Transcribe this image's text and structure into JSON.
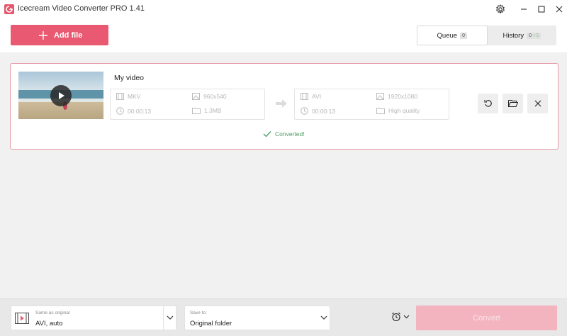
{
  "window": {
    "title": "Icecream Video Converter PRO 1.41"
  },
  "toolbar": {
    "add_file_label": "Add file",
    "tabs": [
      {
        "label": "Queue",
        "count": "0",
        "active": true
      },
      {
        "label": "History",
        "count": "0",
        "count_sub": "+3",
        "active": false
      }
    ]
  },
  "item": {
    "title": "My video",
    "source": {
      "format": "MKV",
      "resolution": "960x540",
      "duration": "00:00:13",
      "size": "1.3MB"
    },
    "target": {
      "format": "AVI",
      "resolution": "1920x1080",
      "duration": "00:00:13",
      "quality": "High quality"
    },
    "status": "Converted!"
  },
  "bottom": {
    "format_select": {
      "caption": "Same as original",
      "value": "AVI, auto"
    },
    "save_select": {
      "caption": "Save to:",
      "value": "Original folder"
    },
    "convert_label": "Convert"
  },
  "colors": {
    "accent": "#e95a72",
    "card_border": "#e59aa6",
    "status_green": "#4a9a63",
    "convert_disabled": "#f3b4c0"
  }
}
